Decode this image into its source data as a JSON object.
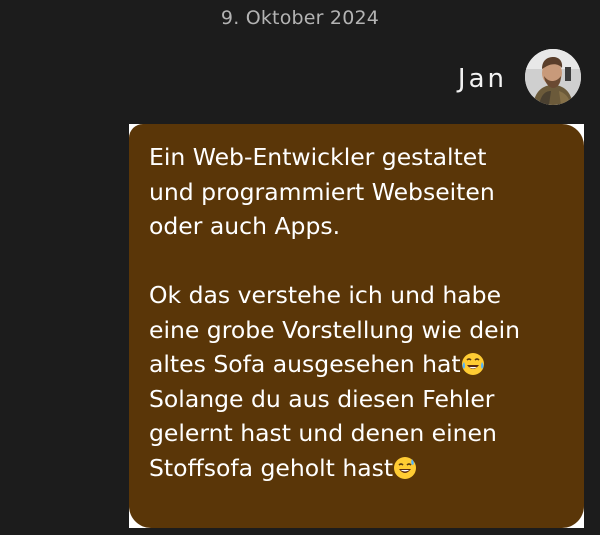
{
  "conversation": {
    "date": "9. Oktober 2024",
    "sender": {
      "name": "Jan",
      "avatar": "user-avatar-photo"
    },
    "message": {
      "lines": [
        "Ein Web-Entwickler gestaltet",
        "und programmiert Webseiten",
        "oder auch Apps.",
        "",
        "Ok das verstehe ich und habe",
        "eine grobe Vorstellung wie dein",
        "altes Sofa ausgesehen hat",
        "Solange du aus diesen Fehler",
        "gelernt hast und denen einen",
        "Stoffsofa geholt hast"
      ],
      "emojis": {
        "laughing": "face-with-tears-of-joy-icon",
        "sweat_smile": "grinning-face-with-sweat-icon"
      }
    },
    "colors": {
      "background": "#1c1c1c",
      "bubble": "#5a3608",
      "bubble_text": "#ffffff",
      "date_text": "#b3b3b3"
    }
  }
}
